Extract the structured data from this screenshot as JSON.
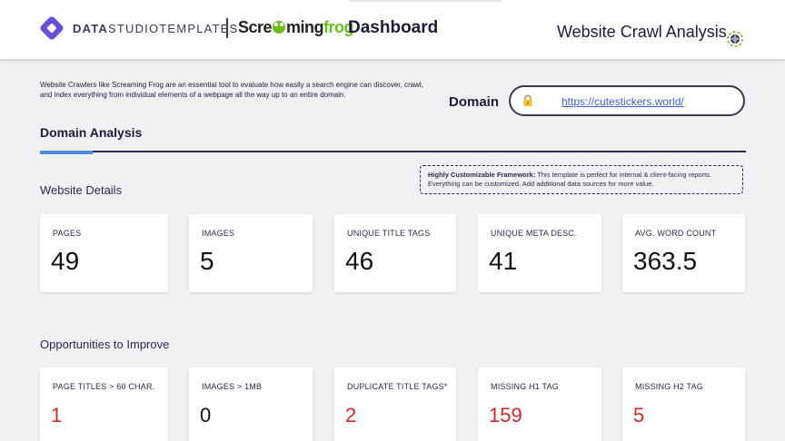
{
  "header": {
    "brand_bold": "DATA",
    "brand_rest": "STUDIOTEMPLATES",
    "sf_part1": "Scre",
    "sf_part2": "ming",
    "sf_part3": "frog",
    "dashboard_label": "Dashboard",
    "report_title": "Website Crawl Analysis",
    "accent_color": "#6a4fd6",
    "frog_color": "#6cbb1f"
  },
  "intro": {
    "text": "Website Crawlers like Screaming Frog are an essential tool to evaluate how easily a search engine can discover, crawl, and index everything from individual elements of a webpage all the way up to an entire domain."
  },
  "domain": {
    "label": "Domain",
    "url": "https://cutestickers.world/"
  },
  "section": {
    "title": "Domain Analysis"
  },
  "callout": {
    "bold": "Highly Customizable Framework:",
    "text": " This template is perfect for internal & client-facing reports. Everything can be customized. Add additional data sources for more value."
  },
  "website_details": {
    "title": "Website Details",
    "cards": [
      {
        "label": "PAGES",
        "value": "49"
      },
      {
        "label": "IMAGES",
        "value": "5"
      },
      {
        "label": "UNIQUE TITLE TAGS",
        "value": "46"
      },
      {
        "label": "UNIQUE META DESC.",
        "value": "41"
      },
      {
        "label": "AVG. WORD COUNT",
        "value": "363.5"
      }
    ]
  },
  "opportunities": {
    "title": "Opportunities to Improve",
    "cards": [
      {
        "label": "PAGE TITLES > 60 CHAR.",
        "value": "1"
      },
      {
        "label": "IMAGES > 1MB",
        "value": "0"
      },
      {
        "label": "DUPLICATE TITLE TAGS*",
        "value": "2"
      },
      {
        "label": "MISSING H1 TAG",
        "value": "159"
      },
      {
        "label": "MISSING H2 TAG",
        "value": "5"
      }
    ],
    "alert_color": "#cc2a2a"
  }
}
